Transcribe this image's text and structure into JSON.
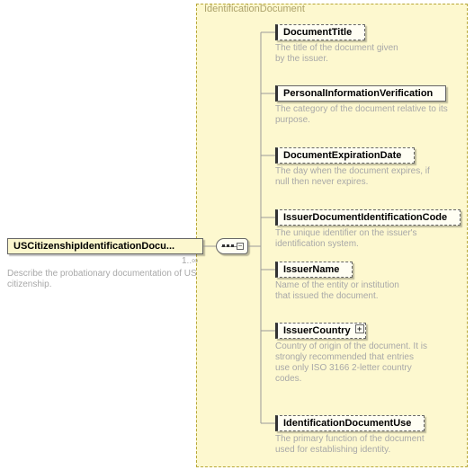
{
  "group": {
    "title": "IdentificationDocument"
  },
  "root": {
    "label": "USCitizenshipIdentificationDocu...",
    "cardinality": "1..∞",
    "description": "Describe the probationary documentation of US citizenship."
  },
  "children": [
    {
      "label": "DocumentTitle",
      "optional": true,
      "desc": "The title of the document given by the issuer."
    },
    {
      "label": "PersonalInformationVerification",
      "optional": false,
      "desc": "The category of the document relative to its purpose."
    },
    {
      "label": "DocumentExpirationDate",
      "optional": true,
      "desc": "The day when the document expires, if null then never expires."
    },
    {
      "label": "IssuerDocumentIdentificationCode",
      "optional": true,
      "desc": "The unique identifier on the issuer's identification system."
    },
    {
      "label": "IssuerName",
      "optional": true,
      "desc": "Name of the entity or institution that issued the document."
    },
    {
      "label": "IssuerCountry",
      "optional": true,
      "expandable": true,
      "desc": "Country of origin of the document. It is strongly recommended that entries use only ISO 3166 2-letter country codes."
    },
    {
      "label": "IdentificationDocumentUse",
      "optional": true,
      "desc": "The primary function of the document used for establishing identity."
    }
  ]
}
